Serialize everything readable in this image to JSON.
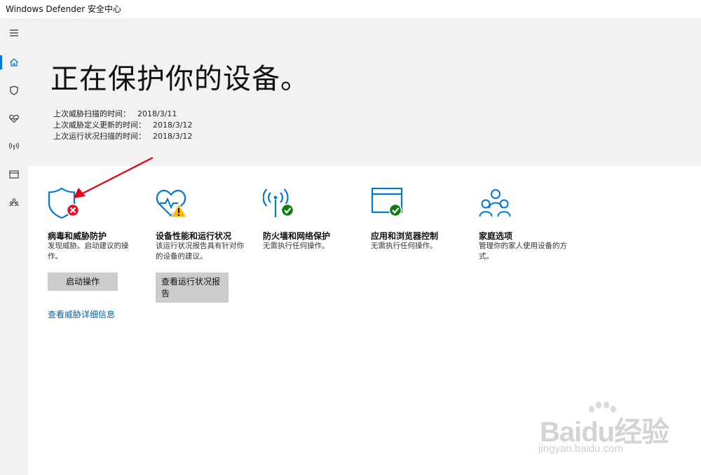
{
  "window": {
    "title": "Windows Defender 安全中心"
  },
  "sidebar": {
    "items": [
      {
        "icon": "hamburger-menu-icon"
      },
      {
        "icon": "home-icon",
        "active": true
      },
      {
        "icon": "shield-icon"
      },
      {
        "icon": "heart-pulse-icon"
      },
      {
        "icon": "wireless-antenna-icon"
      },
      {
        "icon": "browser-window-icon"
      },
      {
        "icon": "family-icon"
      }
    ]
  },
  "hero": {
    "title": "正在保护你的设备。",
    "scans": [
      {
        "label": "上次威胁扫描的时间：",
        "value": "2018/3/11"
      },
      {
        "label": "上次威胁定义更新的时间：",
        "value": "2018/3/12"
      },
      {
        "label": "上次运行状况扫描的时间：",
        "value": "2018/3/12"
      }
    ]
  },
  "cards": [
    {
      "title": "病毒和威胁防护",
      "desc": "发现威胁。启动建议的操作。",
      "status": "error",
      "button": "启动操作",
      "link": "查看威胁详细信息"
    },
    {
      "title": "设备性能和运行状况",
      "desc": "该运行状况报告具有针对你的设备的建议。",
      "status": "warning",
      "button": "查看运行状况报告"
    },
    {
      "title": "防火墙和网络保护",
      "desc": "无需执行任何操作。",
      "status": "ok"
    },
    {
      "title": "应用和浏览器控制",
      "desc": "无需执行任何操作。",
      "status": "ok"
    },
    {
      "title": "家庭选项",
      "desc": "管理你的家人使用设备的方式。",
      "status": "none"
    }
  ],
  "colors": {
    "accent": "#0078d7",
    "error": "#e81123",
    "warning": "#ffb900",
    "ok": "#107c10",
    "annotation_arrow": "#e60012"
  },
  "watermark": {
    "logo": "Baidu经验",
    "url": "jingyan.baidu.com"
  }
}
